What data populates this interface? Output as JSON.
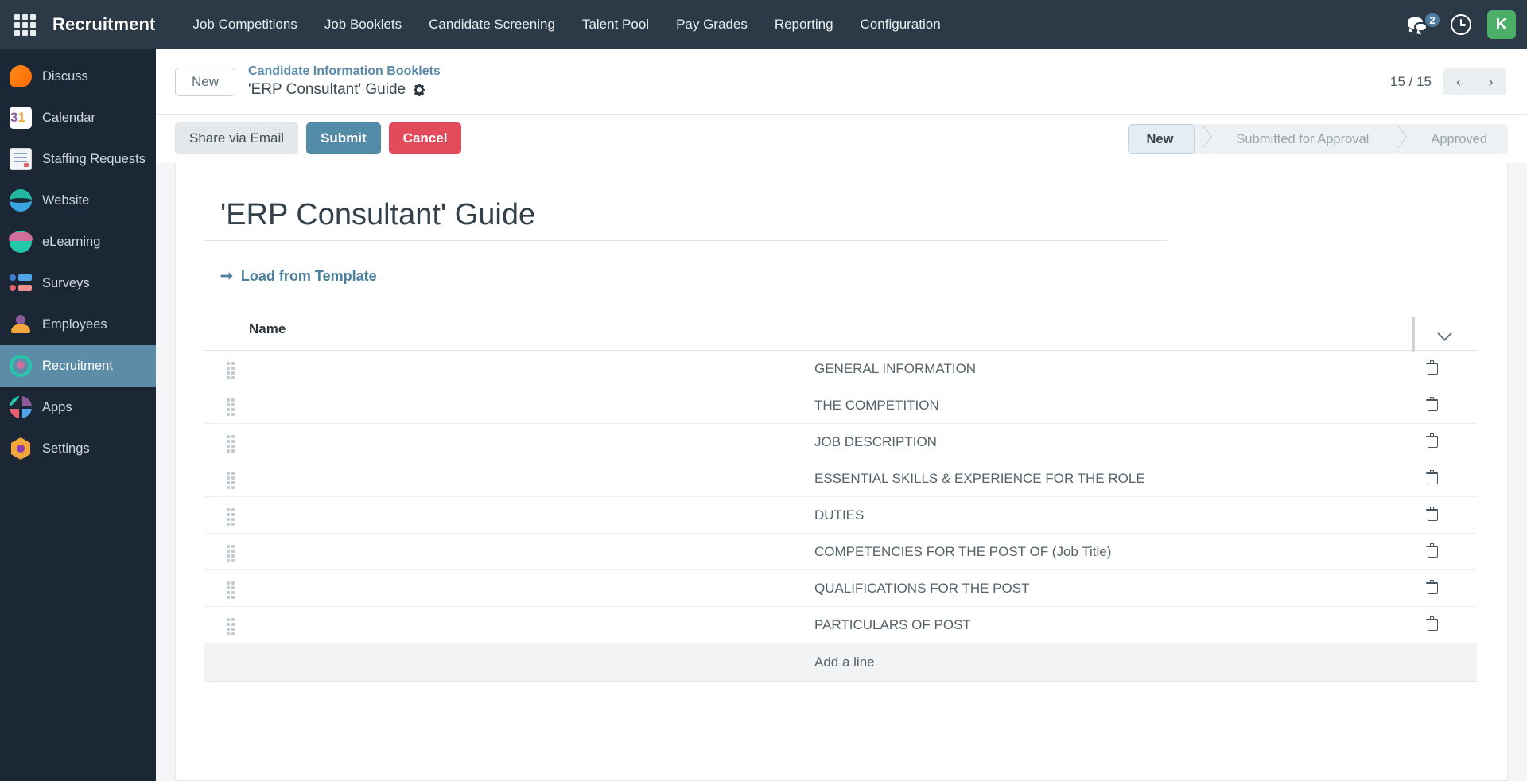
{
  "navbar": {
    "apps_icon": "grid-apps-icon",
    "brand": "Recruitment",
    "menu": [
      {
        "label": "Job Competitions"
      },
      {
        "label": "Job Booklets"
      },
      {
        "label": "Candidate Screening"
      },
      {
        "label": "Talent Pool"
      },
      {
        "label": "Pay Grades"
      },
      {
        "label": "Reporting"
      },
      {
        "label": "Configuration"
      }
    ],
    "messages_icon": "messages-icon",
    "messages_badge": "2",
    "activity_icon": "clock-icon",
    "avatar_initial": "K",
    "avatar_color": "#4caf68",
    "background": "#2b3a46"
  },
  "sidebar": {
    "background": "#1b2735",
    "active_color": "#5d8ca8",
    "items": [
      {
        "label": "Discuss",
        "icon": "discuss-icon",
        "active": false
      },
      {
        "label": "Calendar",
        "icon": "calendar-icon",
        "active": false
      },
      {
        "label": "Staffing Requests",
        "icon": "document-icon",
        "active": false
      },
      {
        "label": "Website",
        "icon": "website-icon",
        "active": false
      },
      {
        "label": "eLearning",
        "icon": "elearning-icon",
        "active": false
      },
      {
        "label": "Surveys",
        "icon": "surveys-icon",
        "active": false
      },
      {
        "label": "Employees",
        "icon": "employees-icon",
        "active": false
      },
      {
        "label": "Recruitment",
        "icon": "recruitment-icon",
        "active": true
      },
      {
        "label": "Apps",
        "icon": "apps-icon",
        "active": false
      },
      {
        "label": "Settings",
        "icon": "settings-icon",
        "active": false
      }
    ]
  },
  "control_panel": {
    "new_button": "New",
    "breadcrumb_parent": "Candidate Information Booklets",
    "breadcrumb_current": "'ERP Consultant' Guide",
    "settings_icon": "gear-icon",
    "pager_count": "15 / 15",
    "prev_icon": "chevron-left-icon",
    "next_icon": "chevron-right-icon"
  },
  "action_bar": {
    "share_label": "Share via Email",
    "submit_label": "Submit",
    "cancel_label": "Cancel",
    "submit_color": "#528ba8",
    "cancel_color": "#e14b5a",
    "statuses": [
      {
        "label": "New",
        "active": true
      },
      {
        "label": "Submitted for Approval",
        "active": false
      },
      {
        "label": "Approved",
        "active": false
      }
    ]
  },
  "form": {
    "title": "'ERP Consultant' Guide",
    "load_template_label": "Load from Template",
    "load_template_icon": "arrow-right-icon",
    "table": {
      "columns": [
        "Name"
      ],
      "optional_columns_icon": "chevron-down-icon",
      "rows": [
        {
          "name": "GENERAL INFORMATION"
        },
        {
          "name": "THE COMPETITION"
        },
        {
          "name": "JOB DESCRIPTION"
        },
        {
          "name": "ESSENTIAL SKILLS & EXPERIENCE FOR THE ROLE"
        },
        {
          "name": "DUTIES"
        },
        {
          "name": "COMPETENCIES FOR THE POST OF (Job Title)"
        },
        {
          "name": "QUALIFICATIONS FOR THE POST"
        },
        {
          "name": "PARTICULARS OF POST"
        }
      ],
      "add_line_label": "Add a line",
      "row_handle_icon": "drag-handle-icon",
      "row_delete_icon": "trash-icon"
    }
  }
}
